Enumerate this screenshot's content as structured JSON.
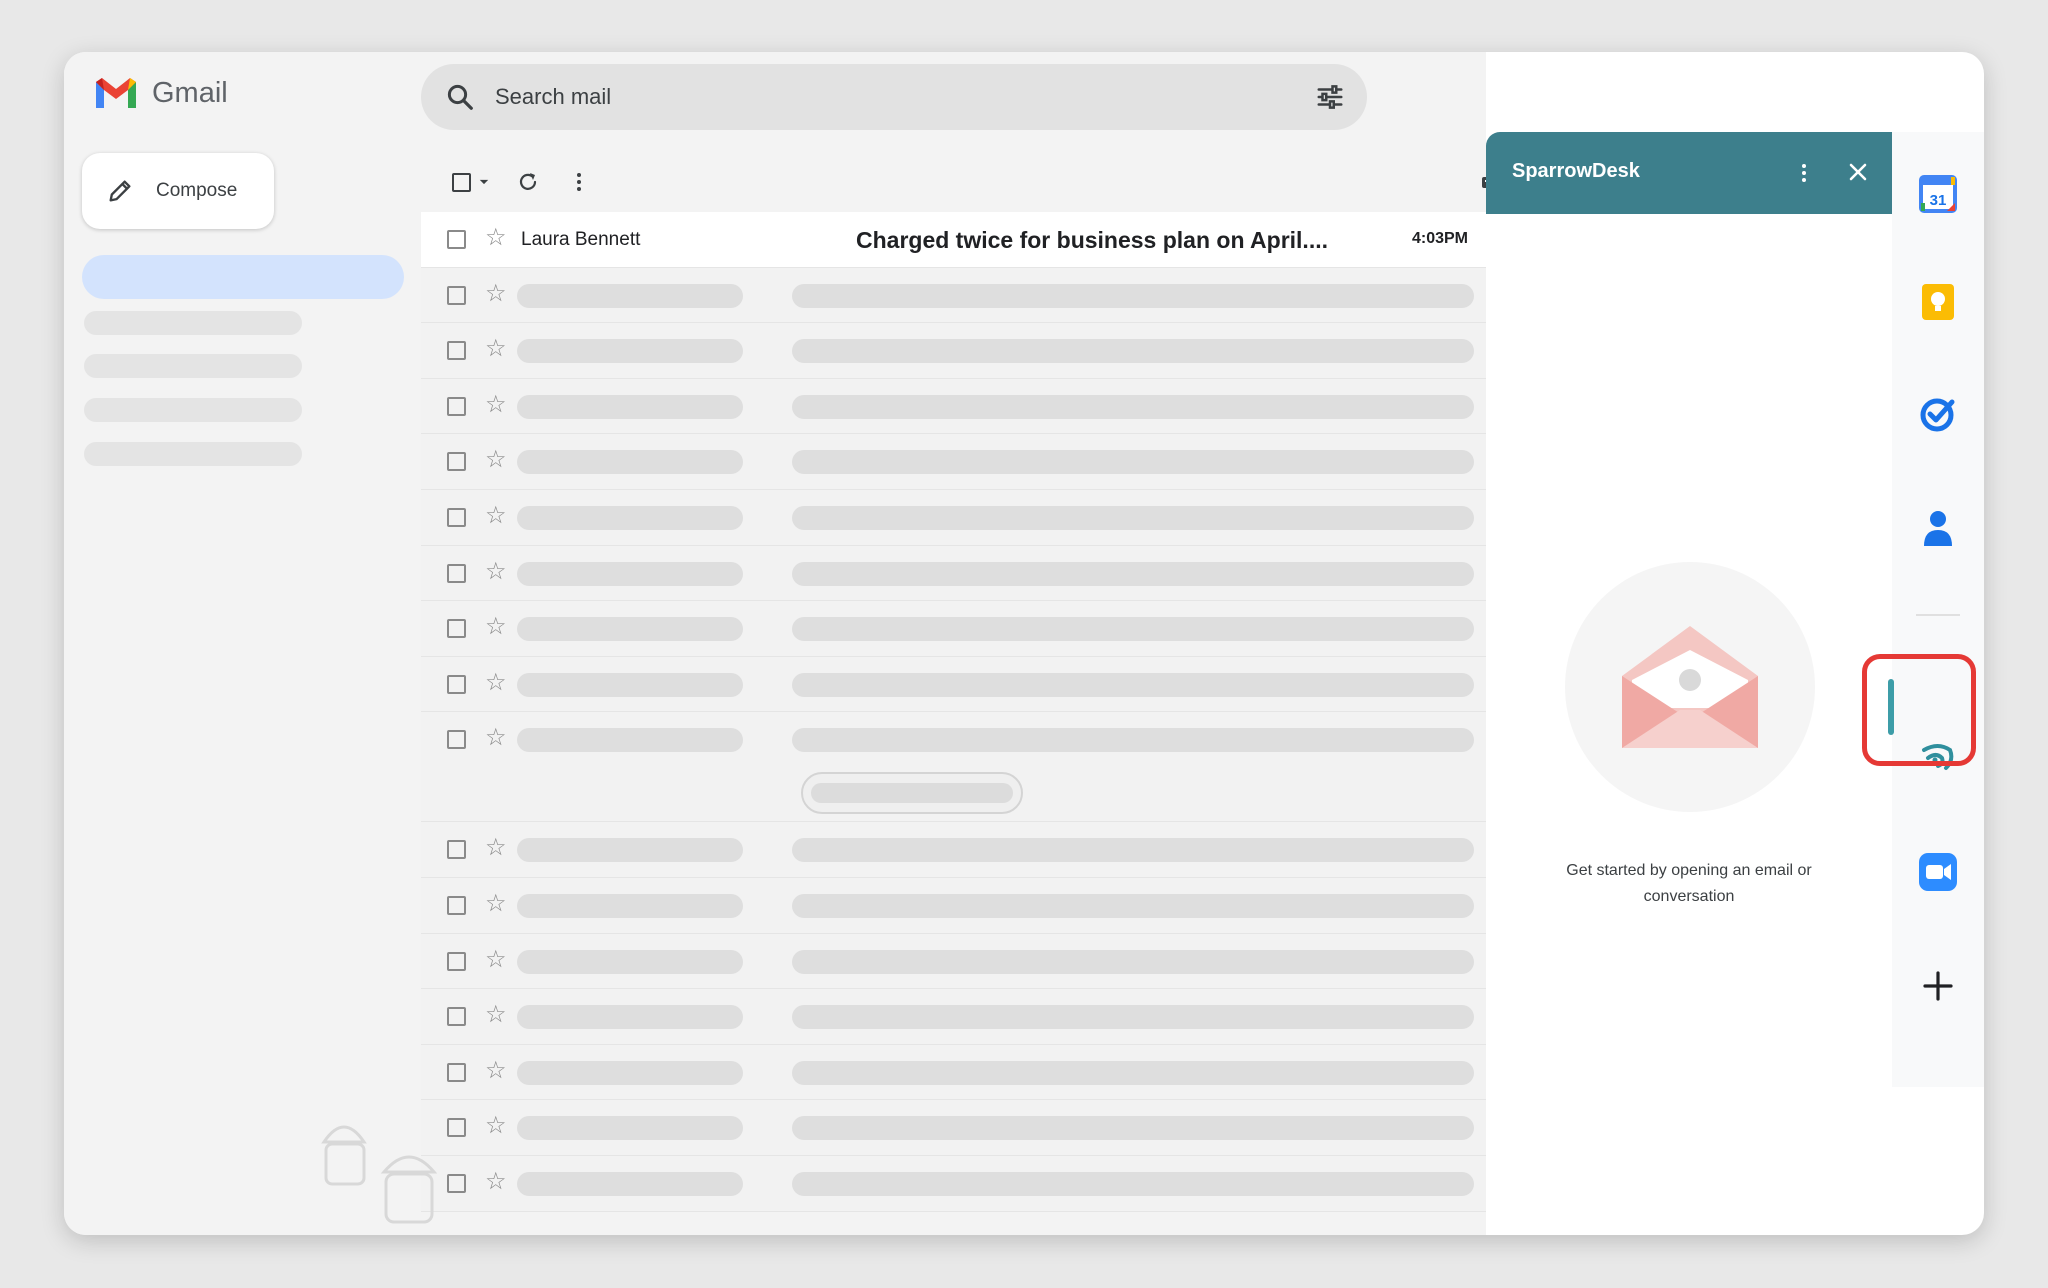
{
  "app": {
    "name": "Gmail"
  },
  "search": {
    "placeholder": "Search mail"
  },
  "compose": {
    "label": "Compose"
  },
  "email_list": {
    "first": {
      "sender": "Laura Bennett",
      "subject": "Charged twice for business plan on April....",
      "time": "4:03PM"
    }
  },
  "panel": {
    "title": "SparrowDesk",
    "empty_message": "Get started by opening an email or conversation"
  },
  "side_rail": {
    "icons": [
      "calendar-icon",
      "keep-icon",
      "tasks-icon",
      "contacts-icon",
      "sparrowdesk-icon",
      "zoom-icon",
      "add-icon"
    ],
    "calendar_day": "31"
  },
  "colors": {
    "panel_header": "#3d7f8c",
    "highlight": "#e53935",
    "nav_active": "#d3e3fd"
  }
}
